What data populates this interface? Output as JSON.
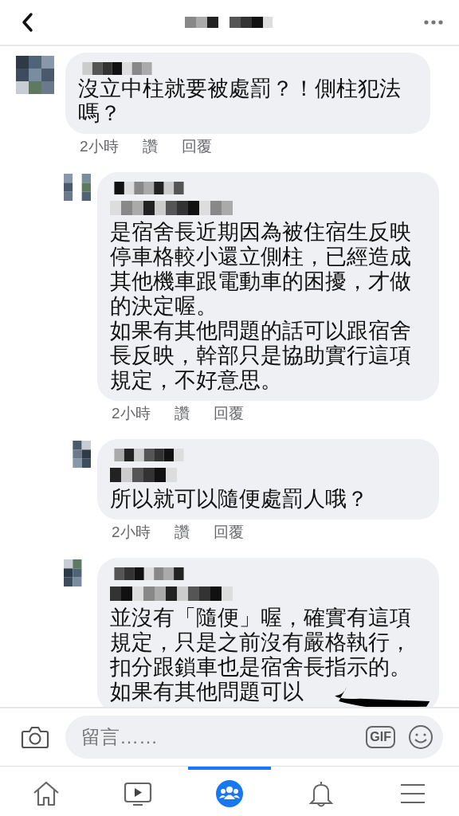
{
  "comments": [
    {
      "kind": "top",
      "has_mention": false,
      "paragraphs": [
        "沒立中柱就要被處罰？！側柱犯法嗎？"
      ],
      "time": "2小時",
      "like": "讚",
      "reply": "回覆"
    },
    {
      "kind": "reply",
      "has_mention": true,
      "paragraphs": [
        "是宿舍長近期因為被住宿生反映停車格較小還立側柱，已經造成其他機車跟電動車的困擾，才做的決定喔。",
        "如果有其他問題的話可以跟宿舍長反映，幹部只是協助實行這項規定，不好意思。"
      ],
      "time": "2小時",
      "like": "讚",
      "reply": "回覆"
    },
    {
      "kind": "reply",
      "has_mention": true,
      "paragraphs": [
        "所以就可以隨便處罰人哦？"
      ],
      "time": "2小時",
      "like": "讚",
      "reply": "回覆"
    },
    {
      "kind": "reply",
      "has_mention": true,
      "paragraphs": [
        "並沒有「隨便」喔，確實有這項規定，只是之前沒有嚴格執行，扣分跟鎖車也是宿舍長指示的。",
        "如果有其他問題可以"
      ],
      "scribbled": true
    }
  ],
  "composer": {
    "placeholder": "留言……",
    "gif": "GIF"
  },
  "nav_tabs": [
    {
      "kind": "home",
      "selected": false
    },
    {
      "kind": "video",
      "selected": false
    },
    {
      "kind": "groups",
      "selected": true
    },
    {
      "kind": "notifications",
      "selected": false
    },
    {
      "kind": "menu",
      "selected": false
    }
  ]
}
